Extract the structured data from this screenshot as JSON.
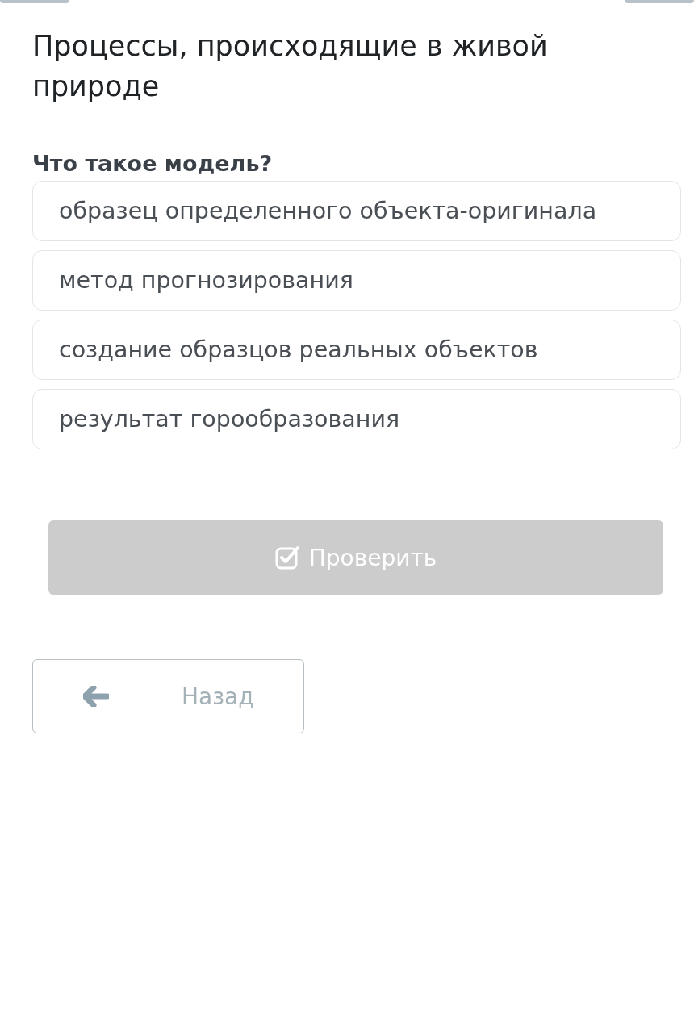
{
  "title": "Процессы, происходящие в живой природе",
  "question": "Что такое модель?",
  "options": [
    {
      "label": "образец определенного объекта-оригинала",
      "selected": false
    },
    {
      "label": "метод прогнозирования",
      "selected": false
    },
    {
      "label": "создание образцов реальных объектов",
      "selected": false
    },
    {
      "label": "результат горообразования",
      "selected": false
    }
  ],
  "check_button": {
    "label": "Проверить",
    "disabled": true
  },
  "back_button": {
    "label": "Назад"
  }
}
